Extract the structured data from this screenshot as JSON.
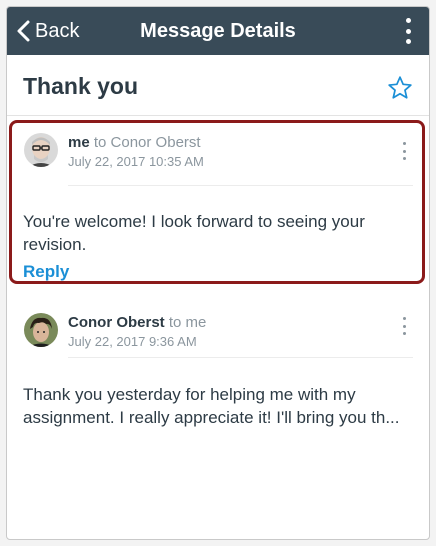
{
  "navbar": {
    "back_label": "Back",
    "title": "Message Details",
    "background_color": "#394b58"
  },
  "conversation": {
    "subject": "Thank you",
    "starred": false,
    "star_icon": "star-outline-icon",
    "accent_color": "#1b8fd6"
  },
  "messages": [
    {
      "author": "me",
      "to_text": "to Conor Oberst",
      "date": "July 22, 2017 10:35 AM",
      "body": "You're welcome! I look forward to seeing your revision.",
      "reply_label": "Reply",
      "highlighted": true,
      "highlight_color": "#8b1a1a"
    },
    {
      "author": "Conor Oberst",
      "to_text": "to me",
      "date": "July 22, 2017 9:36 AM",
      "body": "Thank you yesterday for helping me with my assignment. I really appreciate it! I'll bring you th..."
    }
  ]
}
